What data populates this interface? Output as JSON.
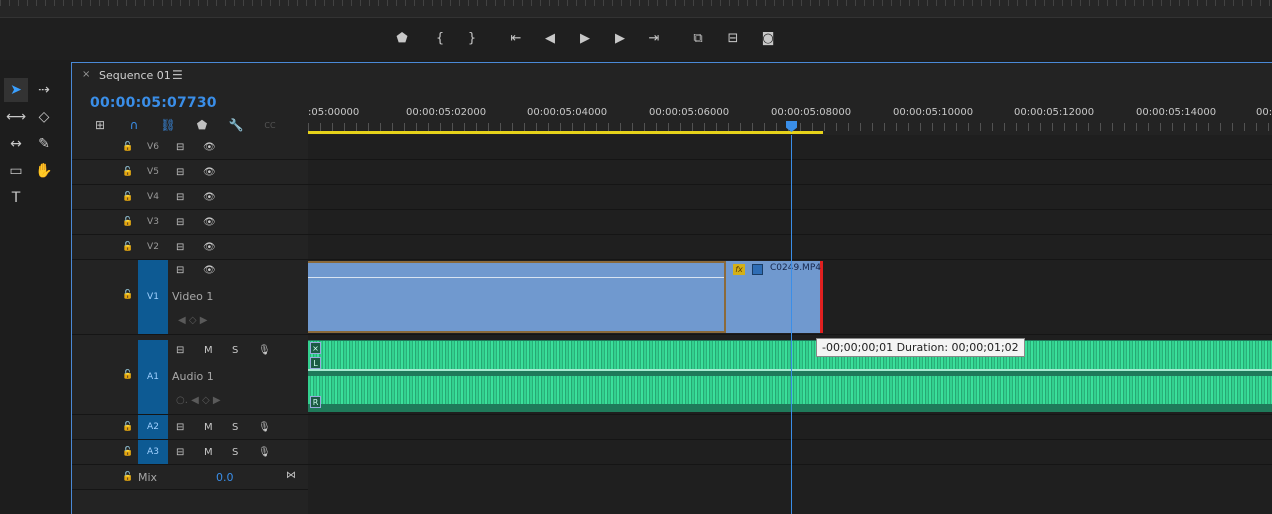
{
  "transport": {
    "buttons": [
      {
        "name": "add-marker-button",
        "glyph": "⬟"
      },
      {
        "name": "mark-in-button",
        "glyph": "{"
      },
      {
        "name": "mark-out-button",
        "glyph": "}"
      },
      {
        "name": "go-to-in-button",
        "glyph": "⇤"
      },
      {
        "name": "step-back-button",
        "glyph": "◀"
      },
      {
        "name": "play-button",
        "glyph": "▶"
      },
      {
        "name": "step-forward-button",
        "glyph": "▶"
      },
      {
        "name": "go-to-out-button",
        "glyph": "⇥"
      },
      {
        "name": "insert-button",
        "glyph": "⧉"
      },
      {
        "name": "overwrite-button",
        "glyph": "⊟"
      },
      {
        "name": "export-frame-button",
        "glyph": "◙"
      }
    ]
  },
  "tools": {
    "items": [
      {
        "name": "selection-tool",
        "glyph": "➤",
        "active": true
      },
      {
        "name": "track-select-tool",
        "glyph": "⇢"
      },
      {
        "name": "ripple-edit-tool",
        "glyph": "⟷"
      },
      {
        "name": "razor-tool",
        "glyph": "◇"
      },
      {
        "name": "slip-tool",
        "glyph": "↔"
      },
      {
        "name": "pen-tool",
        "glyph": "✎"
      },
      {
        "name": "rectangle-tool",
        "glyph": "▭"
      },
      {
        "name": "hand-tool",
        "glyph": "✋"
      },
      {
        "name": "type-tool",
        "glyph": "T"
      }
    ]
  },
  "sequence": {
    "close_glyph": "×",
    "title": "Sequence 01",
    "menu_glyph": "☰",
    "timecode": "00:00:05:07730"
  },
  "header_icons": [
    {
      "name": "insert-nest-icon",
      "glyph": "⊞"
    },
    {
      "name": "snap-icon",
      "glyph": "∩"
    },
    {
      "name": "linked-selection-icon",
      "glyph": "⛓"
    },
    {
      "name": "add-marker-icon",
      "glyph": "⬟"
    },
    {
      "name": "wrench-icon",
      "glyph": "🔧"
    },
    {
      "name": "captions-icon",
      "glyph": "CC"
    }
  ],
  "ruler": {
    "labels": [
      ":05:00000",
      "00:00:05:02000",
      "00:00:05:04000",
      "00:00:05:06000",
      "00:00:05:08000",
      "00:00:05:10000",
      "00:00:05:12000",
      "00:00:05:14000",
      "00:"
    ]
  },
  "tracks": {
    "video": [
      {
        "id": "V6"
      },
      {
        "id": "V5"
      },
      {
        "id": "V4"
      },
      {
        "id": "V3"
      },
      {
        "id": "V2"
      },
      {
        "id": "V1",
        "label": "Video 1"
      }
    ],
    "audio": [
      {
        "id": "A1",
        "label": "Audio 1"
      },
      {
        "id": "A2"
      },
      {
        "id": "A3"
      }
    ],
    "mix": {
      "label": "Mix",
      "value": "0.0"
    },
    "mute_label": "M",
    "solo_label": "S",
    "lock_glyph": "🔓",
    "eye_glyph": "👁",
    "mic_glyph": "🎙"
  },
  "clip": {
    "name": "C0249.MP4",
    "fx_label": "fx"
  },
  "audio_clip": {
    "left_badge": "L",
    "right_badge": "R"
  },
  "tooltip": "-00;00;00;01 Duration: 00;00;01;02",
  "colors": {
    "accent": "#3a8ee8",
    "video_clip": "#7099cf",
    "audio_clip": "#2ab079",
    "work_area": "#e6d21a",
    "clip_end": "#e02020"
  }
}
